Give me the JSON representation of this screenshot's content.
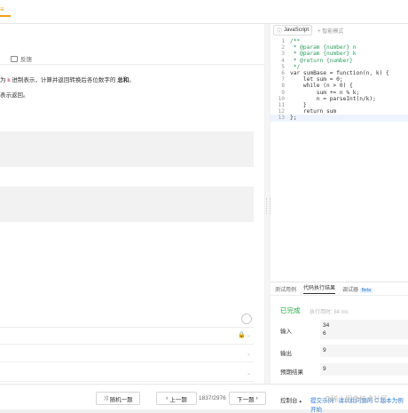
{
  "left": {
    "feedback": "反馈",
    "description_before": "为",
    "description_var": "k",
    "description_middle": "进制表示，计算并返回转换后各位数字的",
    "description_bold": "总和",
    "description_end": "。",
    "description_2": "表示返回。"
  },
  "editor": {
    "language": "JavaScript",
    "smart_mode": "智能模式",
    "lines": [
      {
        "n": "1",
        "t": "/**",
        "c": "cmt"
      },
      {
        "n": "2",
        "t": " * @param {number} n",
        "c": "cmt"
      },
      {
        "n": "3",
        "t": " * @param {number} k",
        "c": "cmt"
      },
      {
        "n": "4",
        "t": " * @return {number}",
        "c": "cmt"
      },
      {
        "n": "5",
        "t": " */",
        "c": "cmt"
      },
      {
        "n": "6",
        "t": "var sumBase = function(n, k) {",
        "c": ""
      },
      {
        "n": "7",
        "t": "    let sum = 0;",
        "c": ""
      },
      {
        "n": "8",
        "t": "    while (n > 0) {",
        "c": ""
      },
      {
        "n": "9",
        "t": "        sum += n % k;",
        "c": ""
      },
      {
        "n": "10",
        "t": "        n = parseInt(n/k);",
        "c": ""
      },
      {
        "n": "11",
        "t": "    }",
        "c": ""
      },
      {
        "n": "12",
        "t": "    return sum",
        "c": ""
      },
      {
        "n": "13",
        "t": "};",
        "c": "cur"
      }
    ]
  },
  "result": {
    "tabs": [
      "测试用例",
      "代码执行结果",
      "调试器"
    ],
    "beta": "Beta",
    "status": "已完成",
    "time": "执行用时: 84 ms",
    "input_label": "输入",
    "input_value_1": "34",
    "input_value_2": "6",
    "output_label": "输出",
    "output_value": "9",
    "expected_label": "预期结果",
    "expected_value": "9"
  },
  "bottom": {
    "random": "随机一题",
    "prev": "上一题",
    "page": "1837/2976",
    "next": "下一题",
    "console": "控制台",
    "submit": "提交示例 . 请以此问题的 C 版本为例开始",
    "watermark": "@稀土掘金技术社区"
  }
}
